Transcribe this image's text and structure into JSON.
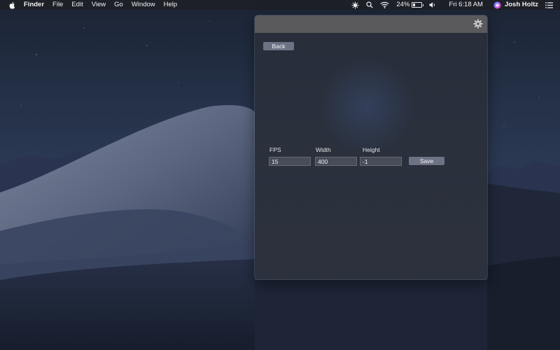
{
  "menubar": {
    "apple_icon": "apple-icon",
    "app_name": "Finder",
    "menus": [
      "File",
      "Edit",
      "View",
      "Go",
      "Window",
      "Help"
    ],
    "status": {
      "app_icon": "bug-icon",
      "search_icon": "search-icon",
      "wifi_icon": "wifi-icon",
      "battery_percent": "24%",
      "battery_level": 0.24,
      "volume_icon": "volume-icon",
      "clock": "Fri 6:18 AM",
      "user_name": "Josh Holtz",
      "notification_icon": "list-icon"
    }
  },
  "panel": {
    "settings_icon": "gear-icon",
    "back_label": "Back",
    "fields": {
      "fps_label": "FPS",
      "fps_value": "15",
      "width_label": "Width",
      "width_value": "400",
      "height_label": "Height",
      "height_value": "-1"
    },
    "save_label": "Save"
  },
  "colors": {
    "menubar_bg": "#1e2026",
    "panel_header": "#5a5a5c",
    "button_bg": "#6c7385",
    "wallpaper_sky": "#25314a"
  }
}
